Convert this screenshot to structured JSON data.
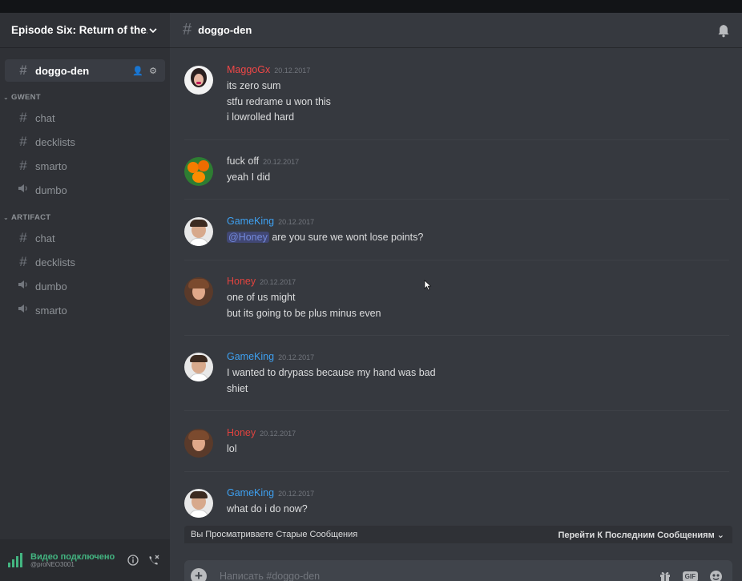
{
  "server": {
    "name": "Episode Six: Return of the..."
  },
  "sidebar": {
    "active_channel": {
      "label": "doggo-den",
      "icon": "hash-icon"
    },
    "categories": [
      {
        "label": "GWENT",
        "channels": [
          {
            "label": "chat",
            "icon": "hash-icon"
          },
          {
            "label": "decklists",
            "icon": "hash-icon"
          },
          {
            "label": "smarto",
            "icon": "hash-icon"
          },
          {
            "label": "dumbo",
            "icon": "speaker-icon"
          }
        ]
      },
      {
        "label": "ARTIFACT",
        "channels": [
          {
            "label": "chat",
            "icon": "hash-icon"
          },
          {
            "label": "decklists",
            "icon": "hash-icon"
          },
          {
            "label": "dumbo",
            "icon": "speaker-icon"
          },
          {
            "label": "smarto",
            "icon": "speaker-icon"
          }
        ]
      }
    ]
  },
  "voice": {
    "status": "Видео подключено",
    "sub": "@proNEO3001"
  },
  "header": {
    "channel": "doggo-den"
  },
  "messages": [
    {
      "author": "MaggoGx",
      "color": "#f04747",
      "time": "20.12.2017",
      "lines": [
        "its zero sum",
        "stfu redrame u won this",
        "i lowrolled hard"
      ]
    },
    {
      "author": "fuck off",
      "color": "#dcddde",
      "time": "20.12.2017",
      "lines": [
        "yeah I did"
      ]
    },
    {
      "author": "GameKing",
      "color": "#3ea0f0",
      "time": "20.12.2017",
      "mention": "@Honey",
      "lines": [
        "are you sure we wont lose points?"
      ]
    },
    {
      "author": "Honey",
      "color": "#e0433f",
      "time": "20.12.2017",
      "lines": [
        "one of us might",
        "but its going to be plus minus even"
      ]
    },
    {
      "author": "GameKing",
      "color": "#3ea0f0",
      "time": "20.12.2017",
      "lines": [
        "I wanted to drypass because my hand was bad",
        "shiet"
      ]
    },
    {
      "author": "Honey",
      "color": "#e0433f",
      "time": "20.12.2017",
      "lines": [
        "lol"
      ]
    },
    {
      "author": "GameKing",
      "color": "#3ea0f0",
      "time": "20.12.2017",
      "lines": [
        "what do i do now?"
      ]
    }
  ],
  "old_messages_bar": {
    "text": "Вы Просматриваете Старые Сообщения",
    "jump": "Перейти К Последним Сообщениям"
  },
  "composer": {
    "placeholder": "Написать #doggo-den"
  },
  "colors": {
    "sidebar": "#2f3136",
    "main": "#36393f",
    "accent": "#7289da",
    "online": "#43b581"
  }
}
